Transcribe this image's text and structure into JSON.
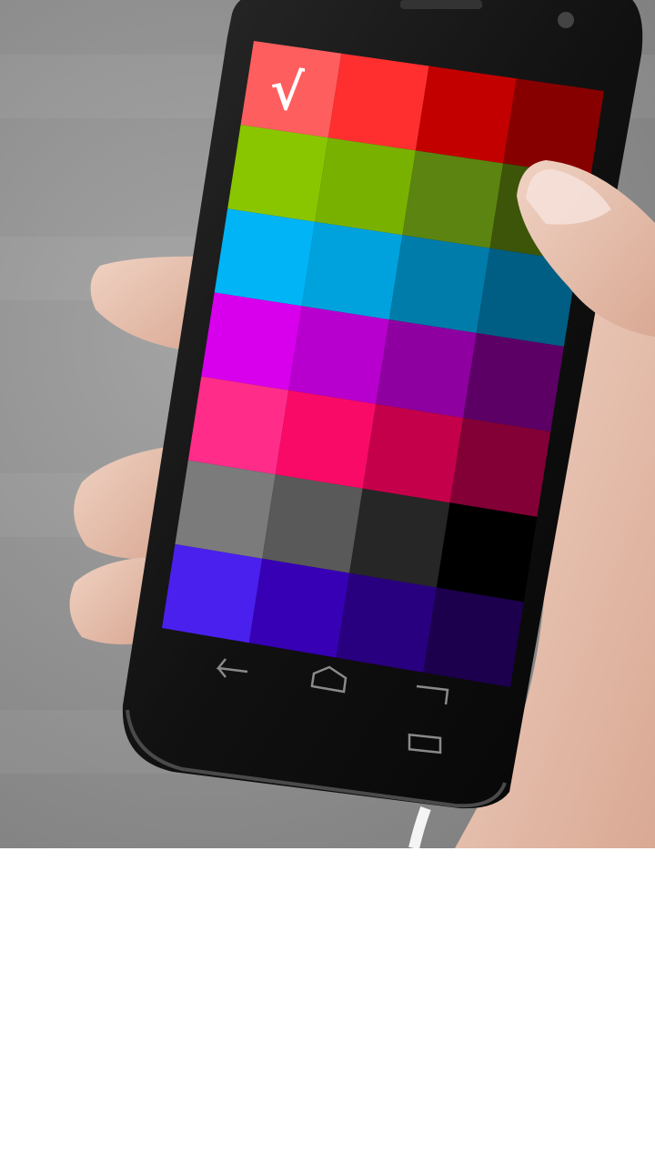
{
  "screen": {
    "selected_mark": "√",
    "palette": [
      [
        "#ff5e5e",
        "#ff2f2f",
        "#c20000",
        "#870000"
      ],
      [
        "#8ac600",
        "#79b100",
        "#5c8410",
        "#3d5508"
      ],
      [
        "#00b4f6",
        "#00a2dd",
        "#007cab",
        "#005d83"
      ],
      [
        "#d800ec",
        "#b800ce",
        "#8e009f",
        "#5c0066"
      ],
      [
        "#ff2c8a",
        "#fa0a67",
        "#c5004b",
        "#830036"
      ],
      [
        "#7b7b7b",
        "#595959",
        "#262626",
        "#000000"
      ],
      [
        "#4a20ee",
        "#3700b5",
        "#28007f",
        "#1c004e"
      ]
    ],
    "selected_row": 0,
    "selected_col": 0
  },
  "nav_buttons": [
    "back-icon",
    "home-icon",
    "recent-apps-icon"
  ],
  "colors": {
    "phone_body": "#121212",
    "skin": "#e8c4b2"
  }
}
